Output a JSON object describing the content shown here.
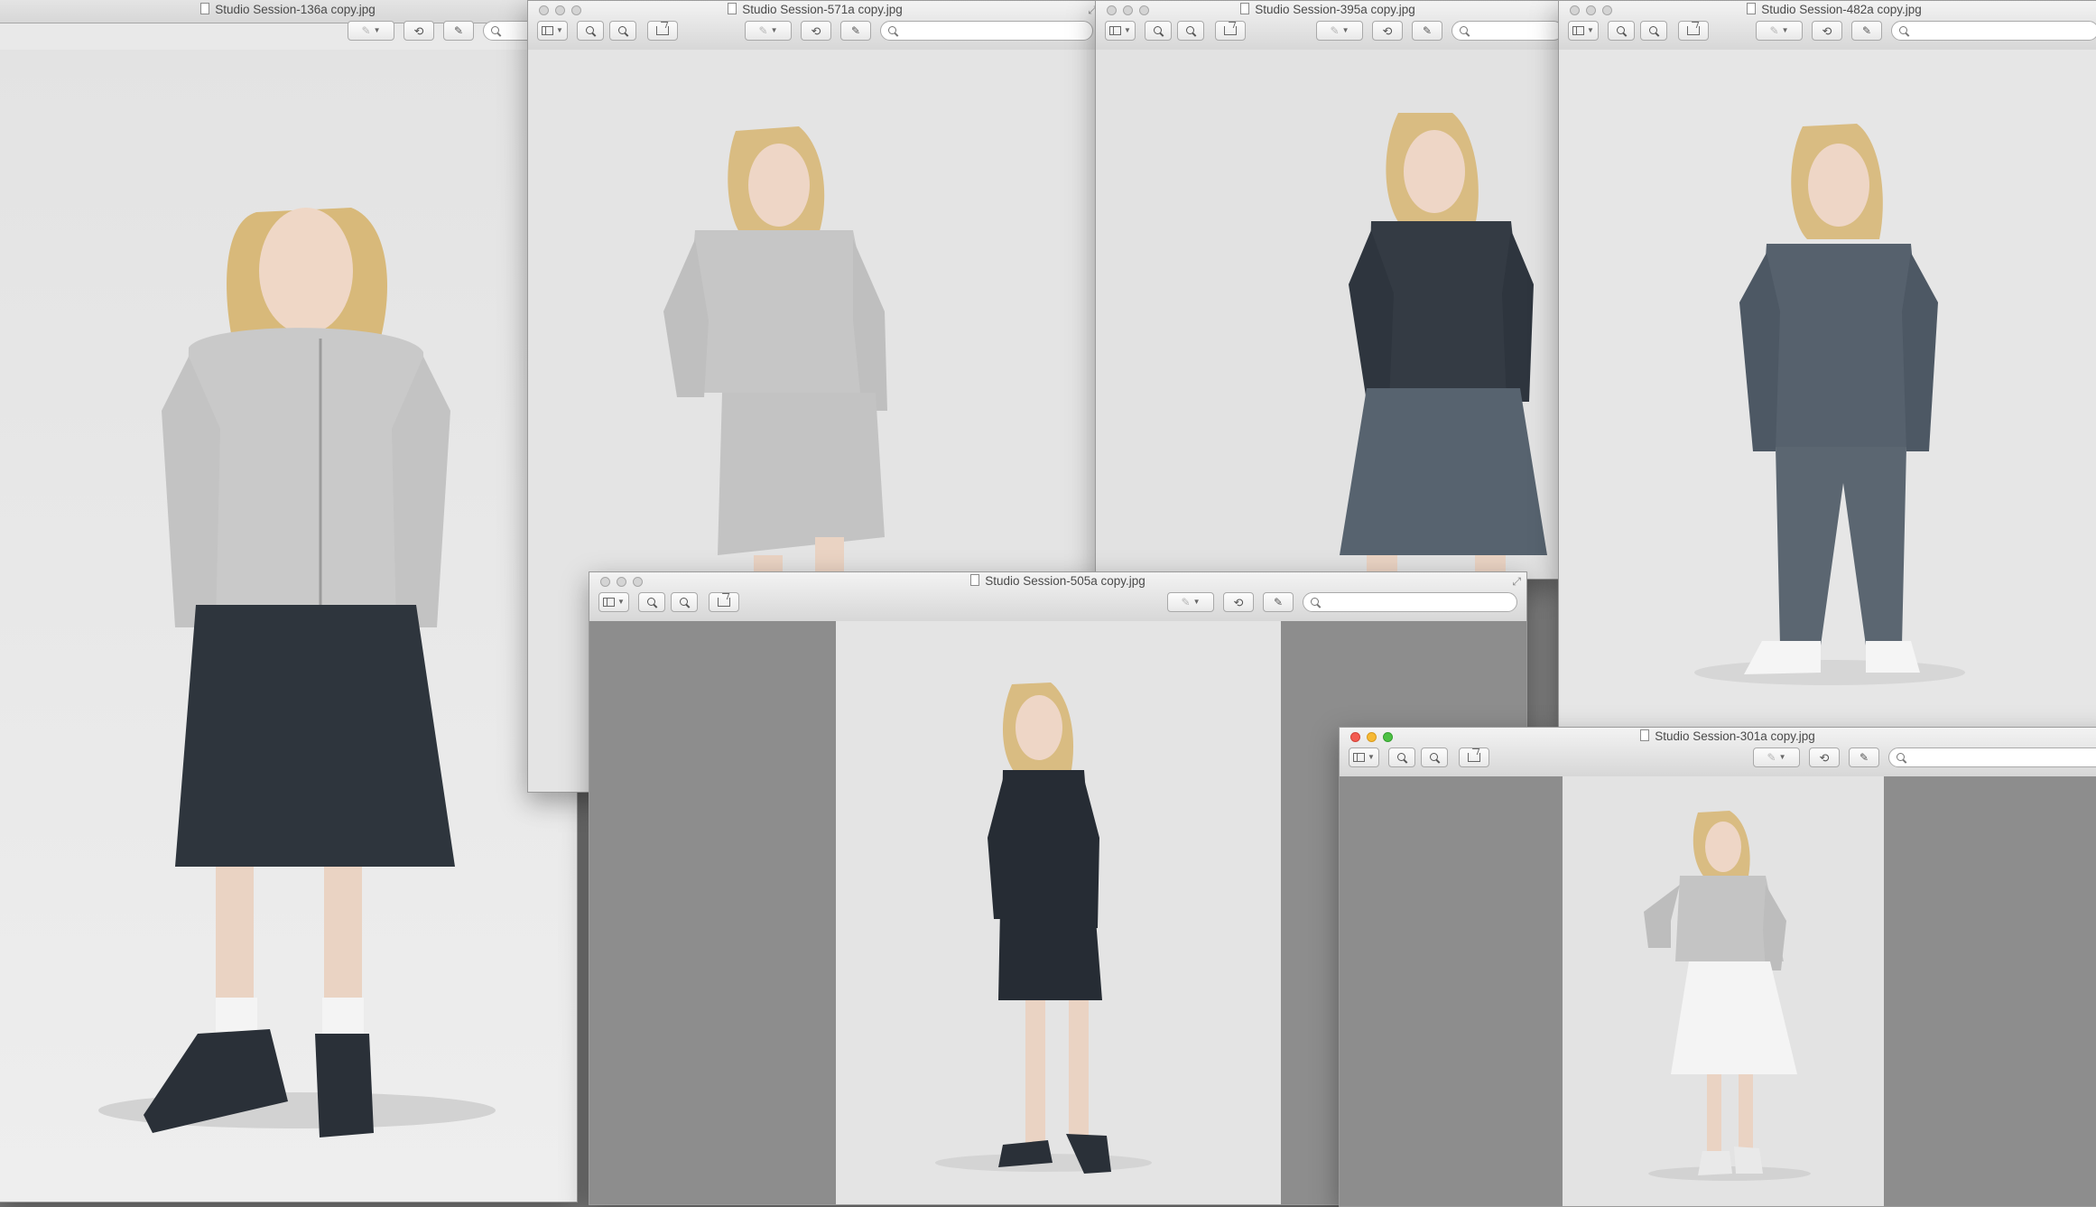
{
  "windows": {
    "w136": {
      "title": "Studio Session-136a copy.jpg"
    },
    "w571": {
      "title": "Studio Session-571a copy.jpg"
    },
    "w395": {
      "title": "Studio Session-395a copy.jpg"
    },
    "w482": {
      "title": "Studio Session-482a copy.jpg"
    },
    "w505": {
      "title": "Studio Session-505a copy.jpg"
    },
    "w301": {
      "title": "Studio Session-301a copy.jpg"
    }
  },
  "toolbar": {
    "rotate_label": "⟲",
    "resize_icon_label": "⤢",
    "annotate_icon_label": "✎"
  },
  "icons": {
    "sidebar": "sidebar-icon",
    "zoom_out": "zoom-out-icon",
    "zoom_in": "zoom-in-icon",
    "share": "share-icon",
    "annotate": "pencil-icon",
    "rotate": "rotate-icon",
    "edit": "edit-icon",
    "search": "magnifier-icon"
  },
  "colors": {
    "close_light": "#f35b51",
    "minimize_light": "#f6b935",
    "zoom_light": "#4dc144",
    "photo_background": "#e6e6e6",
    "window_background": "#8d8d8d"
  }
}
